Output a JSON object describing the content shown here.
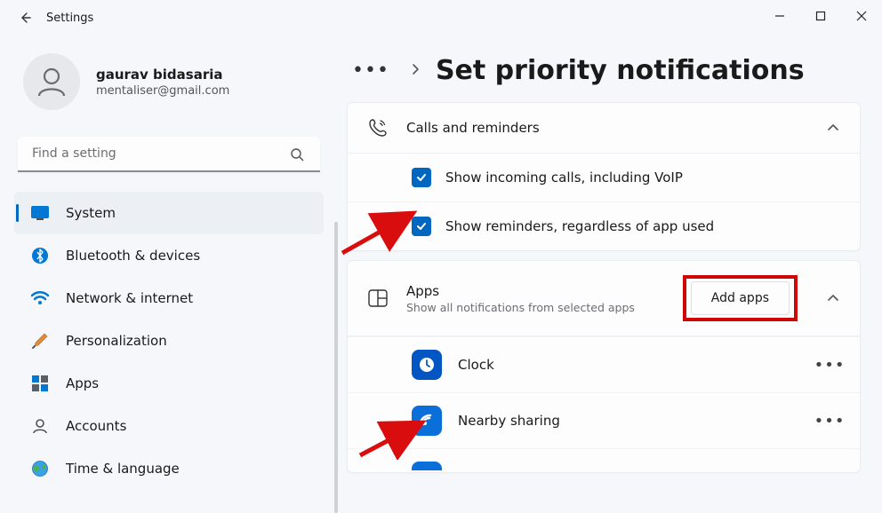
{
  "title": "Settings",
  "profile": {
    "name": "gaurav bidasaria",
    "email": "mentaliser@gmail.com"
  },
  "search": {
    "placeholder": "Find a setting"
  },
  "sidebar": {
    "items": [
      {
        "label": "System"
      },
      {
        "label": "Bluetooth & devices"
      },
      {
        "label": "Network & internet"
      },
      {
        "label": "Personalization"
      },
      {
        "label": "Apps"
      },
      {
        "label": "Accounts"
      },
      {
        "label": "Time & language"
      }
    ]
  },
  "page": {
    "title": "Set priority notifications"
  },
  "calls_section": {
    "header": "Calls and reminders",
    "options": [
      {
        "label": "Show incoming calls, including VoIP"
      },
      {
        "label": "Show reminders, regardless of app used"
      }
    ]
  },
  "apps_section": {
    "title": "Apps",
    "sub": "Show all notifications from selected apps",
    "button": "Add apps",
    "items": [
      {
        "name": "Clock"
      },
      {
        "name": "Nearby sharing"
      }
    ]
  }
}
